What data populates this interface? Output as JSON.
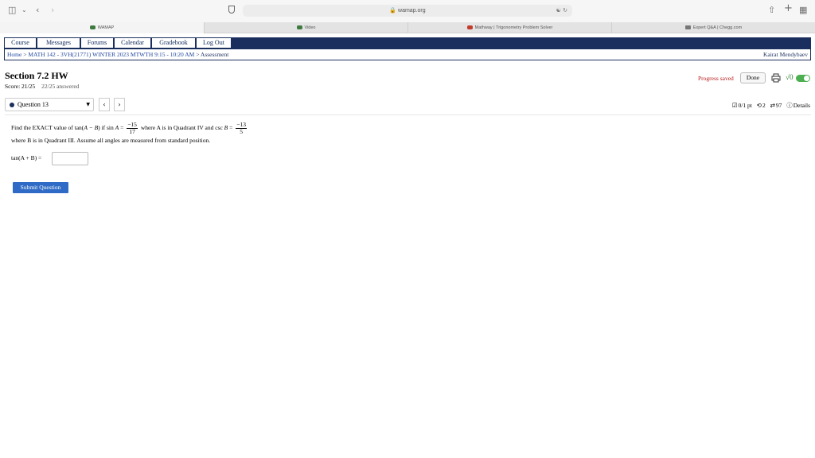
{
  "browser": {
    "url": "wamap.org",
    "tabs": [
      {
        "label": "WAMAP",
        "active": true
      },
      {
        "label": "Video",
        "active": false
      },
      {
        "label": "Mathway | Trigonometry Problem Solver",
        "active": false
      },
      {
        "label": "Expert Q&A | Chegg.com",
        "active": false
      }
    ]
  },
  "nav": {
    "items": [
      "Course",
      "Messages",
      "Forums",
      "Calendar",
      "Gradebook",
      "Log Out"
    ]
  },
  "breadcrumb": {
    "home": "Home",
    "sep": " > ",
    "course": "MATH 142 - 3VH(21771) WINTER 2023 MTWTH 9:15 - 10:20 AM",
    "current": "Assessment"
  },
  "user": {
    "name": "Kairat Mendybaev"
  },
  "assessment": {
    "title": "Section 7.2 HW",
    "score": "Score: 21/25",
    "answered": "22/25 answered",
    "progress_saved": "Progress saved",
    "done_label": "Done",
    "sqrt_label": "√0"
  },
  "question": {
    "selector_label": "Question 13",
    "points": "0/1 pt",
    "retries": "2",
    "tries": "97",
    "details": "Details",
    "line1_a": "Find the EXACT value of tan(",
    "line1_b": "A − B",
    "line1_c": ") if sin ",
    "var_A": "A",
    "eq": " = ",
    "sinA_num": "−15",
    "sinA_den": "17",
    "line1_d": " where A is in Quadrant IV and csc ",
    "var_B": "B",
    "cscB_num": "−13",
    "cscB_den": "5",
    "line2": "where B is in Quadrant III. Assume all angles are measured from standard position.",
    "answer_prefix": "tan(A + B) =",
    "submit_label": "Submit Question"
  },
  "colors": {
    "nav_bg": "#1a2f5e",
    "link": "#2147a0",
    "progress": "#b71c1c",
    "submit_bg": "#2f6bc6",
    "toggle_on": "#4caf50"
  }
}
